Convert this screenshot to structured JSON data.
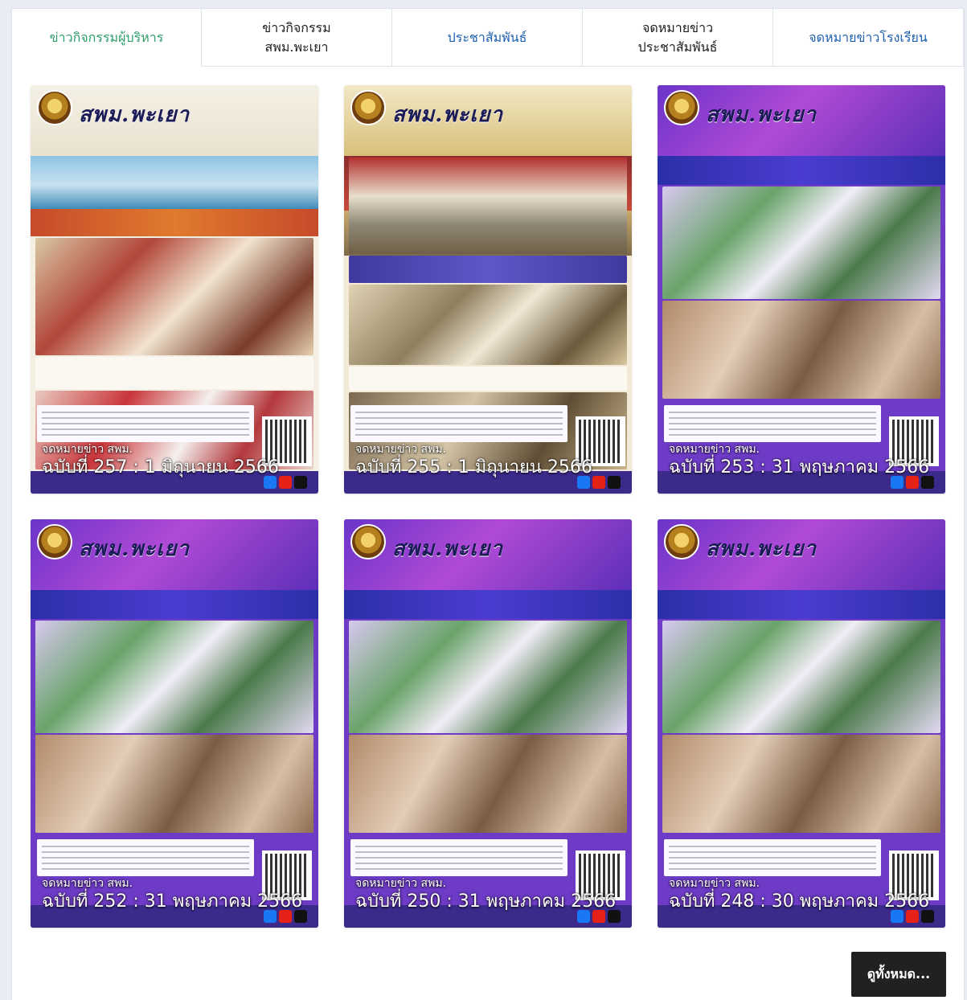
{
  "tabs": [
    {
      "label": "ข่าวกิจกรรมผู้บริหาร",
      "color": "#2e9e6b",
      "active": true
    },
    {
      "label": "ข่าวกิจกรรม\nสพม.พะเยา",
      "color": "#1c1c1c",
      "active": false
    },
    {
      "label": "ประชาสัมพันธ์",
      "color": "#1e5fb0",
      "active": false
    },
    {
      "label": "จดหมายข่าว\nประชาสัมพันธ์",
      "color": "#1c1c1c",
      "active": false
    },
    {
      "label": "จดหมายข่าวโรงเรียน",
      "color": "#1e5fb0",
      "active": false
    }
  ],
  "cards": [
    {
      "caption": "จดหมายข่าว สพม.",
      "issue": "ฉบับที่ 257 : 1 มิถุนายน 2566",
      "masthead": "สพม.พะเยา",
      "theme": "lake"
    },
    {
      "caption": "จดหมายข่าว สพม.",
      "issue": "ฉบับที่ 255 : 1 มิถุนายน 2566",
      "masthead": "สพม.พะเยา",
      "theme": "meeting"
    },
    {
      "caption": "จดหมายข่าว สพม.",
      "issue": "ฉบับที่ 253 : 31 พฤษภาคม 2566",
      "masthead": "สพม.พะเยา",
      "theme": "purple"
    },
    {
      "caption": "จดหมายข่าว สพม.",
      "issue": "ฉบับที่ 252 : 31 พฤษภาคม 2566",
      "masthead": "สพม.พะเยา",
      "theme": "purple"
    },
    {
      "caption": "จดหมายข่าว สพม.",
      "issue": "ฉบับที่ 250 : 31 พฤษภาคม 2566",
      "masthead": "สพม.พะเยา",
      "theme": "purple"
    },
    {
      "caption": "จดหมายข่าว สพม.",
      "issue": "ฉบับที่ 248 : 30 พฤษภาคม 2566",
      "masthead": "สพม.พะเยา",
      "theme": "purple"
    }
  ],
  "view_all_label": "ดูทั้งหมด..."
}
